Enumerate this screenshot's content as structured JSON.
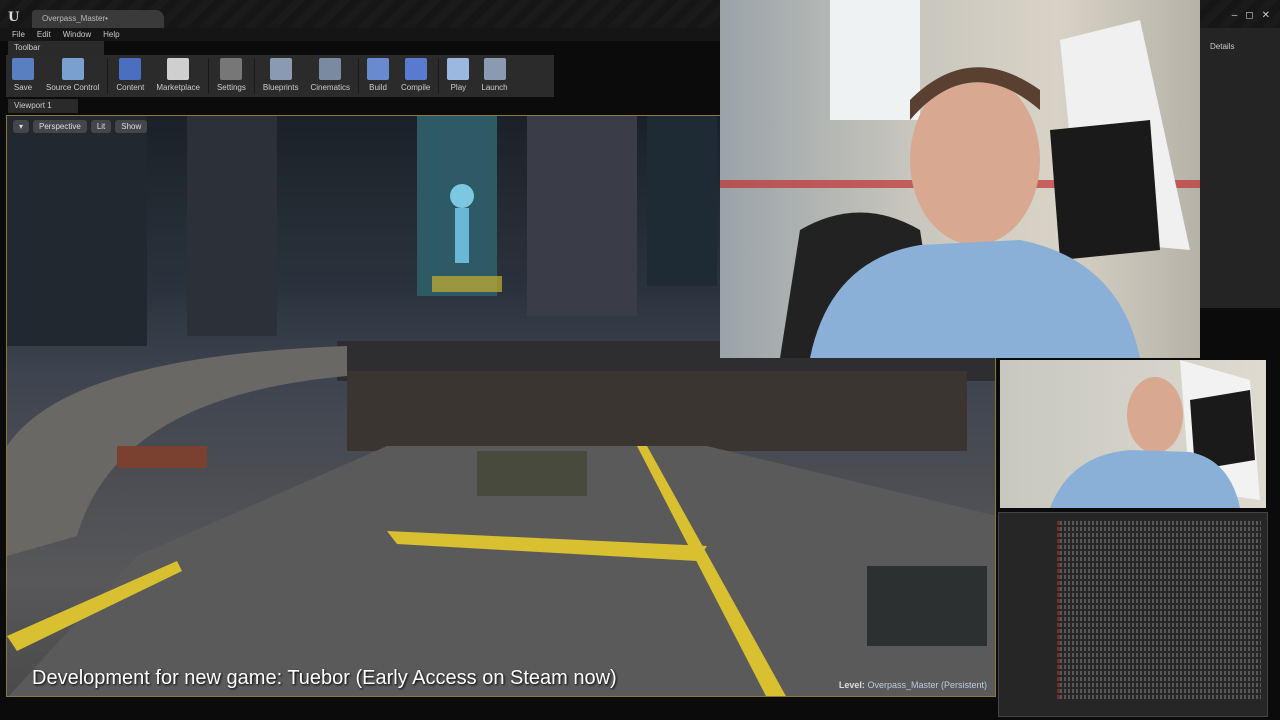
{
  "window": {
    "logo": "U",
    "tab_title": "Overpass_Master•",
    "controls": [
      "–",
      "◻",
      "✕"
    ]
  },
  "menu": [
    "File",
    "Edit",
    "Window",
    "Help"
  ],
  "toolbar_tab": "Toolbar",
  "toolbar": [
    {
      "label": "Save",
      "color": "#5a7fc0"
    },
    {
      "label": "Source Control",
      "color": "#7aa0d0"
    },
    {
      "label": "Content",
      "color": "#4a6fc0"
    },
    {
      "label": "Marketplace",
      "color": "#cfcfcf"
    },
    {
      "label": "Settings",
      "color": "#777"
    },
    {
      "label": "Blueprints",
      "color": "#8a9ab0"
    },
    {
      "label": "Cinematics",
      "color": "#7a8aa0"
    },
    {
      "label": "Build",
      "color": "#6a8ad0"
    },
    {
      "label": "Compile",
      "color": "#5a7ad0"
    },
    {
      "label": "Play",
      "color": "#9ab8e0"
    },
    {
      "label": "Launch",
      "color": "#8a9ab0"
    }
  ],
  "viewport": {
    "tab": "Viewport 1",
    "perspective": "Perspective",
    "lit": "Lit",
    "show": "Show",
    "level_prefix": "Level:",
    "level_name": "Overpass_Master (Persistent)"
  },
  "details_tab": "Details",
  "caption": "Development for new game: Tuebor (Early Access on Steam now)"
}
